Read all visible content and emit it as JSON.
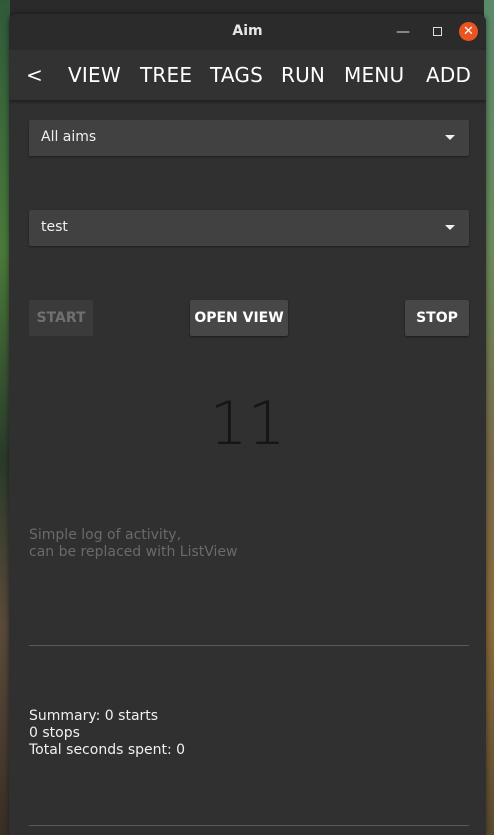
{
  "window": {
    "title": "Aim"
  },
  "menu": {
    "back": "<",
    "items": [
      "VIEW",
      "TREE",
      "TAGS",
      "RUN",
      "MENU",
      "ADD"
    ]
  },
  "aim_select": {
    "selected": "All aims"
  },
  "task_select": {
    "selected": "test"
  },
  "buttons": {
    "start": "START",
    "open_view": "OPEN VIEW",
    "stop": "STOP"
  },
  "counter": "11",
  "log": {
    "line1": "Simple log of activity,",
    "line2": "can be replaced with ListView"
  },
  "summary": {
    "line1": "Summary: 0 starts",
    "line2": "0 stops",
    "line3": "Total seconds spent: 0"
  },
  "colors": {
    "close_button": "#e95420",
    "window_bg": "#303030"
  }
}
